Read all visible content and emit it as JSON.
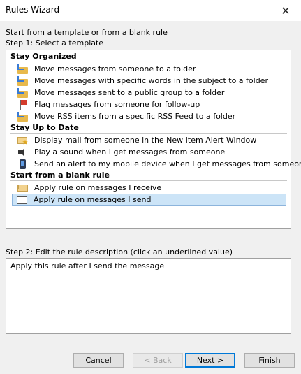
{
  "window": {
    "title": "Rules Wizard",
    "close_glyph": "✕"
  },
  "intro": "Start from a template or from a blank rule",
  "step1_label": "Step 1: Select a template",
  "groups": [
    {
      "label": "Stay Organized"
    },
    {
      "label": "Stay Up to Date"
    },
    {
      "label": "Start from a blank rule"
    }
  ],
  "items": [
    {
      "label": "Move messages from someone to a folder",
      "icon": "folder-move-icon"
    },
    {
      "label": "Move messages with specific words in the subject to a folder",
      "icon": "folder-move-icon"
    },
    {
      "label": "Move messages sent to a public group to a folder",
      "icon": "folder-move-icon"
    },
    {
      "label": "Flag messages from someone for follow-up",
      "icon": "flag-icon"
    },
    {
      "label": "Move RSS items from a specific RSS Feed to a folder",
      "icon": "folder-move-icon"
    },
    {
      "label": "Display mail from someone in the New Item Alert Window",
      "icon": "new-item-alert-icon"
    },
    {
      "label": "Play a sound when I get messages from someone",
      "icon": "speaker-icon"
    },
    {
      "label": "Send an alert to my mobile device when I get messages from someone",
      "icon": "mobile-device-icon"
    },
    {
      "label": "Apply rule on messages I receive",
      "icon": "envelope-icon"
    },
    {
      "label": "Apply rule on messages I send",
      "icon": "sent-mail-icon",
      "selected": true
    }
  ],
  "step2_label": "Step 2: Edit the rule description (click an underlined value)",
  "description": "Apply this rule after I send the message",
  "buttons": {
    "cancel": "Cancel",
    "back": "< Back",
    "next": "Next >",
    "finish": "Finish"
  }
}
